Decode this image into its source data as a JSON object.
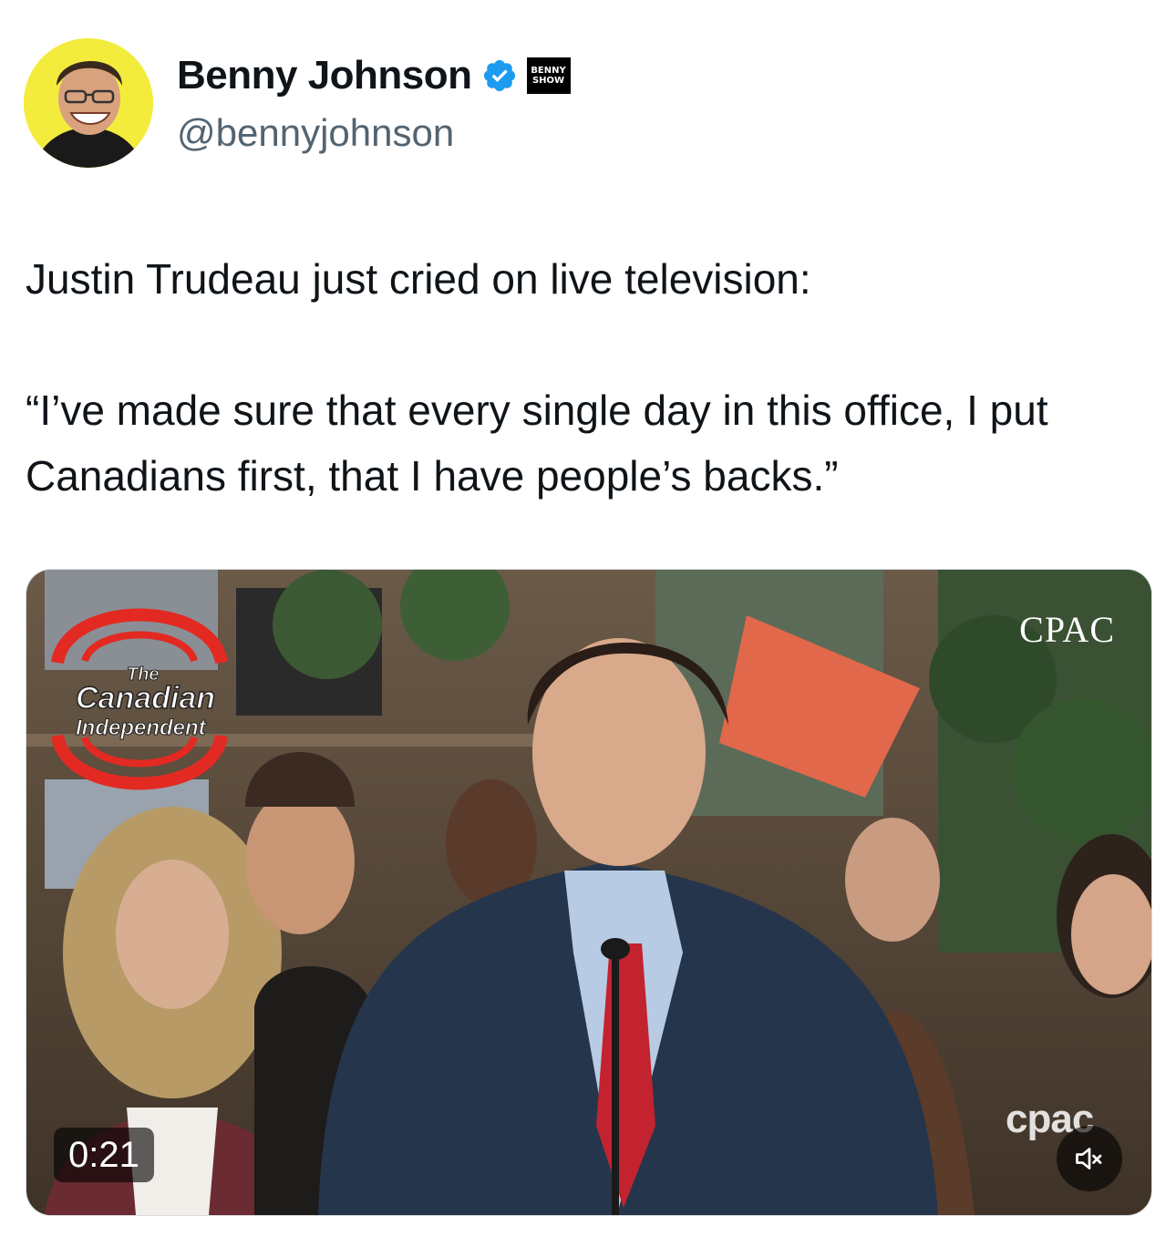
{
  "tweet": {
    "author": {
      "name": "Benny Johnson",
      "handle": "@bennyjohnson",
      "affiliation_badge": [
        "BENNY",
        "SHOW"
      ],
      "verified_color": "#1d9bf0"
    },
    "text": "Justin Trudeau just cried on live television:\n\n“I’ve made sure that every single day in this office, I put Canadians first, that I have people’s backs.”",
    "media": {
      "type": "video",
      "duration": "0:21",
      "watermark_top": "CPAC",
      "watermark_bottom": "cpac",
      "logo": {
        "line1": "The",
        "line2": "Canadian",
        "line3": "Independent"
      },
      "mute_icon": "speaker-muted-icon"
    }
  }
}
